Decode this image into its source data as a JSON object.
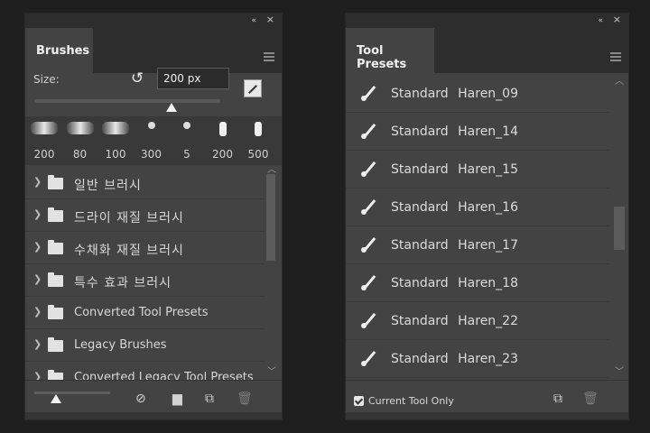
{
  "brushes_panel": {
    "title": "Brushes",
    "collapse_icon": "«",
    "close_icon": "×",
    "size_label": "Size:",
    "size_value": "200 px",
    "size_slider_fraction": 0.74,
    "presets": [
      {
        "value": "200",
        "kind": "soft"
      },
      {
        "value": "80",
        "kind": "soft"
      },
      {
        "value": "100",
        "kind": "soft"
      },
      {
        "value": "300",
        "kind": "round"
      },
      {
        "value": "5",
        "kind": "round"
      },
      {
        "value": "200",
        "kind": "stroke"
      },
      {
        "value": "500",
        "kind": "stroke"
      }
    ],
    "groups": [
      {
        "label": "일반 브러시",
        "korean": true
      },
      {
        "label": "드라이 재질 브러시",
        "korean": true
      },
      {
        "label": "수채화 재질 브러시",
        "korean": true
      },
      {
        "label": "특수 효과 브러시",
        "korean": true
      },
      {
        "label": "Converted Tool Presets",
        "korean": false
      },
      {
        "label": "Legacy Brushes",
        "korean": false
      },
      {
        "label": "Converted Legacy Tool Presets",
        "korean": false
      }
    ],
    "footer_icons": [
      "eye-visibility-icon",
      "new-folder-icon",
      "new-preset-icon",
      "trash-icon"
    ]
  },
  "tool_presets_panel": {
    "title": "Tool Presets",
    "collapse_icon": "«",
    "close_icon": "×",
    "items": [
      "Standard Haren_09",
      "Standard Haren_14",
      "Standard Haren_15",
      "Standard Haren_16",
      "Standard Haren_17",
      "Standard Haren_18",
      "Standard Haren_22",
      "Standard Haren_23"
    ],
    "current_tool_only_label": "Current Tool Only",
    "current_tool_only_checked": true,
    "footer_icons": [
      "new-preset-icon",
      "trash-icon"
    ]
  }
}
